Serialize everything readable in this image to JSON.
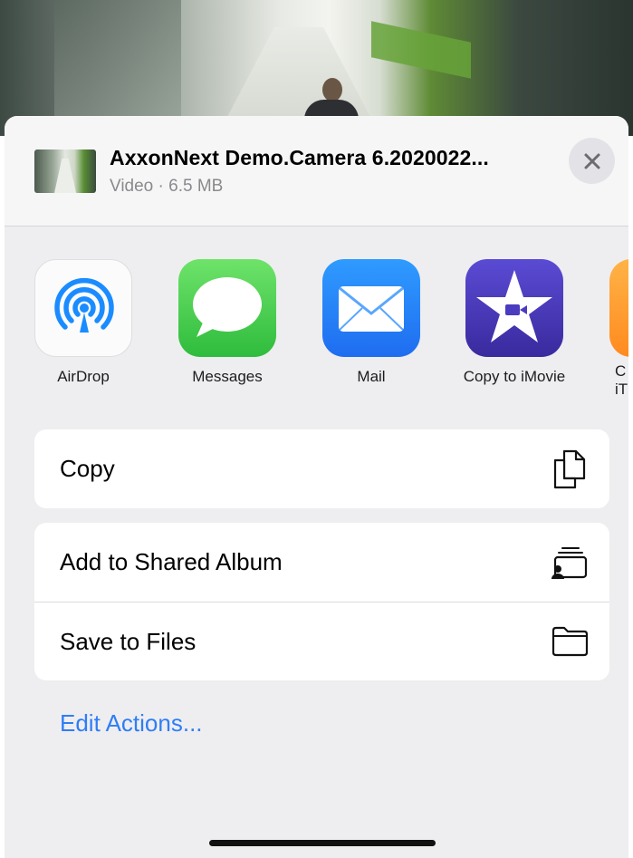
{
  "header": {
    "file_title": "AxxonNext Demo.Camera 6.2020022...",
    "file_subtitle": "Video · 6.5 MB"
  },
  "apps": [
    {
      "label": "AirDrop",
      "icon": "airdrop-icon"
    },
    {
      "label": "Messages",
      "icon": "messages-icon"
    },
    {
      "label": "Mail",
      "icon": "mail-icon"
    },
    {
      "label": "Copy to iMovie",
      "icon": "imovie-icon"
    }
  ],
  "partial_app": {
    "label_line1": "C",
    "label_line2": "iT"
  },
  "actions": {
    "group1": [
      {
        "label": "Copy",
        "icon": "copy-icon"
      }
    ],
    "group2": [
      {
        "label": "Add to Shared Album",
        "icon": "shared-album-icon"
      },
      {
        "label": "Save to Files",
        "icon": "folder-icon"
      }
    ]
  },
  "edit_actions_label": "Edit Actions...",
  "colors": {
    "link": "#2f7df6",
    "sheet_bg": "#eeeef0",
    "messages_green": "#34c759",
    "mail_blue": "#1f7bf2",
    "imovie_purple": "#4b3bbf"
  }
}
